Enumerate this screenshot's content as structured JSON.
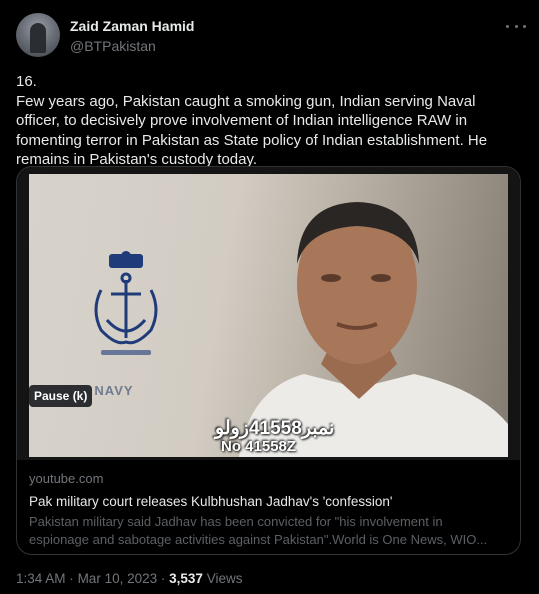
{
  "author": {
    "name": "Zaid Zaman Hamid",
    "handle": "@BTPakistan"
  },
  "tweet": {
    "text": "16.\nFew years ago, Pakistan caught a smoking gun, Indian serving Naval officer, to decisively prove involvement of Indian intelligence RAW in fomenting terror in Pakistan as State policy of Indian establishment. He remains in Pakistan's custody today."
  },
  "video": {
    "emblem_text": "INDIAN NAVY",
    "subtitle_urdu": "نمبر41558زولو",
    "subtitle_number": "No 41558Z",
    "pause_label": "Pause (k)"
  },
  "card": {
    "domain": "youtube.com",
    "title": "Pak military court releases Kulbhushan Jadhav's 'confession'",
    "description": "Pakistan military said Jadhav has been convicted for \"his involvement in\nespionage and sabotage activities against Pakistan\".World is One News, WIO..."
  },
  "footer": {
    "time": "1:34 AM",
    "sep1": "·",
    "date": "Mar 10, 2023",
    "sep2": "·",
    "views_count": "3,537",
    "views_label": "Views"
  },
  "icons": {
    "more": "more-horizontal-icon",
    "emblem": "navy-emblem-icon"
  },
  "colors": {
    "background": "#000000",
    "text": "#e7e9ea",
    "muted": "#71767b",
    "border": "#2f3336"
  }
}
